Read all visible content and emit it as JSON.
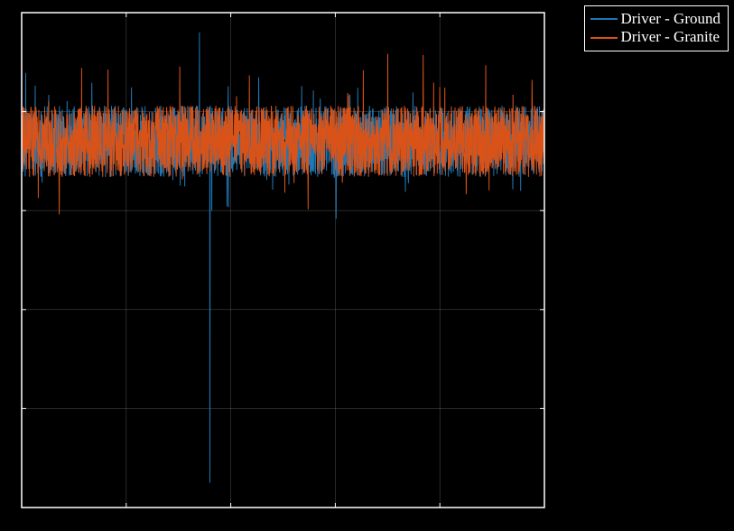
{
  "chart_data": {
    "type": "line",
    "title": "",
    "xlabel": "",
    "ylabel": "",
    "xlim": [
      0,
      100
    ],
    "ylim": [
      -60,
      40
    ],
    "xticks": [
      0,
      20,
      40,
      60,
      80,
      100
    ],
    "yticks": [
      -60,
      -40,
      -20,
      0,
      20,
      40
    ],
    "grid": true,
    "legend_position": "outside top-right",
    "series": [
      {
        "name": "Driver - Ground",
        "color": "#1f77b4",
        "baseline": 13,
        "noise_band": [
          6,
          22
        ],
        "outliers": [
          {
            "x": 34,
            "y": 36
          },
          {
            "x": 36,
            "y": -55
          }
        ],
        "values_summary": "dense noise centered ≈13, roughly 6–22 band; single large negative spike to ≈ -55 near x≈36 preceded by positive spike to ≈36 near x≈34"
      },
      {
        "name": "Driver - Granite",
        "color": "#d95319",
        "baseline": 13,
        "noise_band": [
          6,
          22
        ],
        "outliers": [
          {
            "x": 80,
            "y": 25
          }
        ],
        "values_summary": "dense noise centered ≈13, roughly 6–22 band; modest positive spike to ≈25 near x≈80"
      }
    ]
  },
  "legend": {
    "items": [
      {
        "label": "Driver - Ground",
        "color": "#1f77b4"
      },
      {
        "label": "Driver - Granite",
        "color": "#d95319"
      }
    ]
  }
}
